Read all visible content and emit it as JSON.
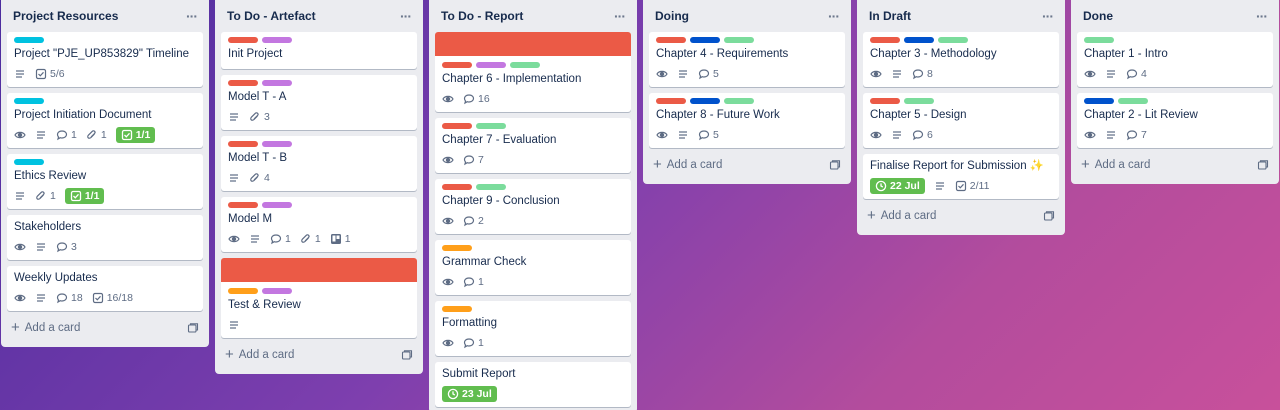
{
  "colors": {
    "red": "#eb5a46",
    "purple": "#c377e0",
    "blue": "#0079bf",
    "green": "#61bd4f",
    "sky": "#00c2e0",
    "lime": "#7bdc9c",
    "orange": "#ff9f1a",
    "navy": "#0052cc"
  },
  "add_card_label": "Add a card",
  "lists": [
    {
      "title": "Project Resources",
      "cards": [
        {
          "labels": [
            "sky"
          ],
          "title": "Project \"PJE_UP853829\" Timeline",
          "badges": [
            {
              "icon": "description-icon"
            },
            {
              "icon": "checklist-icon",
              "text": "5/6"
            }
          ]
        },
        {
          "labels": [
            "sky"
          ],
          "title": "Project Initiation Document",
          "badges": [
            {
              "icon": "watch-icon"
            },
            {
              "icon": "description-icon"
            },
            {
              "icon": "comment-icon",
              "text": "1"
            },
            {
              "icon": "attachment-icon",
              "text": "1"
            },
            {
              "icon": "checklist-icon",
              "text": "1/1",
              "green": true
            }
          ]
        },
        {
          "labels": [
            "sky"
          ],
          "title": "Ethics Review",
          "badges": [
            {
              "icon": "description-icon"
            },
            {
              "icon": "attachment-icon",
              "text": "1"
            },
            {
              "icon": "checklist-icon",
              "text": "1/1",
              "green": true
            }
          ]
        },
        {
          "labels": [],
          "title": "Stakeholders",
          "badges": [
            {
              "icon": "watch-icon"
            },
            {
              "icon": "description-icon"
            },
            {
              "icon": "comment-icon",
              "text": "3"
            }
          ]
        },
        {
          "labels": [],
          "title": "Weekly Updates",
          "badges": [
            {
              "icon": "watch-icon"
            },
            {
              "icon": "description-icon"
            },
            {
              "icon": "comment-icon",
              "text": "18"
            },
            {
              "icon": "checklist-icon",
              "text": "16/18"
            }
          ]
        }
      ]
    },
    {
      "title": "To Do - Artefact",
      "cards": [
        {
          "labels": [
            "red",
            "purple"
          ],
          "title": "Init Project",
          "badges": []
        },
        {
          "labels": [
            "red",
            "purple"
          ],
          "title": "Model T - A",
          "badges": [
            {
              "icon": "description-icon"
            },
            {
              "icon": "attachment-icon",
              "text": "3"
            }
          ]
        },
        {
          "labels": [
            "red",
            "purple"
          ],
          "title": "Model T - B",
          "badges": [
            {
              "icon": "description-icon"
            },
            {
              "icon": "attachment-icon",
              "text": "4"
            }
          ]
        },
        {
          "labels": [
            "red",
            "purple"
          ],
          "title": "Model M",
          "badges": [
            {
              "icon": "watch-icon"
            },
            {
              "icon": "description-icon"
            },
            {
              "icon": "comment-icon",
              "text": "1"
            },
            {
              "icon": "attachment-icon",
              "text": "1"
            },
            {
              "icon": "trello-icon",
              "text": "1"
            }
          ]
        },
        {
          "cover": "red",
          "labels": [
            "orange",
            "purple"
          ],
          "title": "Test & Review",
          "badges": [
            {
              "icon": "description-icon"
            }
          ]
        }
      ]
    },
    {
      "title": "To Do - Report",
      "cards": [
        {
          "cover": "red",
          "labels": [
            "red",
            "purple",
            "lime"
          ],
          "title": "Chapter 6 - Implementation",
          "badges": [
            {
              "icon": "watch-icon"
            },
            {
              "icon": "comment-icon",
              "text": "16"
            }
          ]
        },
        {
          "labels": [
            "red",
            "lime"
          ],
          "title": "Chapter 7 - Evaluation",
          "badges": [
            {
              "icon": "watch-icon"
            },
            {
              "icon": "comment-icon",
              "text": "7"
            }
          ]
        },
        {
          "labels": [
            "red",
            "lime"
          ],
          "title": "Chapter 9 - Conclusion",
          "badges": [
            {
              "icon": "watch-icon"
            },
            {
              "icon": "comment-icon",
              "text": "2"
            }
          ]
        },
        {
          "labels": [
            "orange"
          ],
          "title": "Grammar Check",
          "badges": [
            {
              "icon": "watch-icon"
            },
            {
              "icon": "comment-icon",
              "text": "1"
            }
          ]
        },
        {
          "labels": [
            "orange"
          ],
          "title": "Formatting",
          "badges": [
            {
              "icon": "watch-icon"
            },
            {
              "icon": "comment-icon",
              "text": "1"
            }
          ]
        },
        {
          "labels": [],
          "title": "Submit Report",
          "badges": [
            {
              "icon": "clock-icon",
              "text": "23 Jul",
              "green": true
            }
          ]
        }
      ]
    },
    {
      "title": "Doing",
      "cards": [
        {
          "labels": [
            "red",
            "navy",
            "lime"
          ],
          "title": "Chapter 4 - Requirements",
          "badges": [
            {
              "icon": "watch-icon"
            },
            {
              "icon": "description-icon"
            },
            {
              "icon": "comment-icon",
              "text": "5"
            }
          ]
        },
        {
          "labels": [
            "red",
            "navy",
            "lime"
          ],
          "title": "Chapter 8 - Future Work",
          "badges": [
            {
              "icon": "watch-icon"
            },
            {
              "icon": "description-icon"
            },
            {
              "icon": "comment-icon",
              "text": "5"
            }
          ]
        }
      ]
    },
    {
      "title": "In Draft",
      "cards": [
        {
          "labels": [
            "red",
            "navy",
            "lime"
          ],
          "title": "Chapter 3 - Methodology",
          "badges": [
            {
              "icon": "watch-icon"
            },
            {
              "icon": "description-icon"
            },
            {
              "icon": "comment-icon",
              "text": "8"
            }
          ]
        },
        {
          "labels": [
            "red",
            "lime"
          ],
          "title": "Chapter 5 - Design",
          "badges": [
            {
              "icon": "watch-icon"
            },
            {
              "icon": "description-icon"
            },
            {
              "icon": "comment-icon",
              "text": "6"
            }
          ]
        },
        {
          "labels": [],
          "title": "Finalise Report for Submission ✨",
          "badges": [
            {
              "icon": "clock-icon",
              "text": "22 Jul",
              "green": true
            },
            {
              "icon": "description-icon"
            },
            {
              "icon": "checklist-icon",
              "text": "2/11"
            }
          ]
        }
      ]
    },
    {
      "title": "Done",
      "cards": [
        {
          "labels": [
            "lime"
          ],
          "title": "Chapter 1 - Intro",
          "badges": [
            {
              "icon": "watch-icon"
            },
            {
              "icon": "description-icon"
            },
            {
              "icon": "comment-icon",
              "text": "4"
            }
          ]
        },
        {
          "labels": [
            "navy",
            "lime"
          ],
          "title": "Chapter 2 - Lit Review",
          "badges": [
            {
              "icon": "watch-icon"
            },
            {
              "icon": "description-icon"
            },
            {
              "icon": "comment-icon",
              "text": "7"
            }
          ]
        }
      ]
    }
  ]
}
